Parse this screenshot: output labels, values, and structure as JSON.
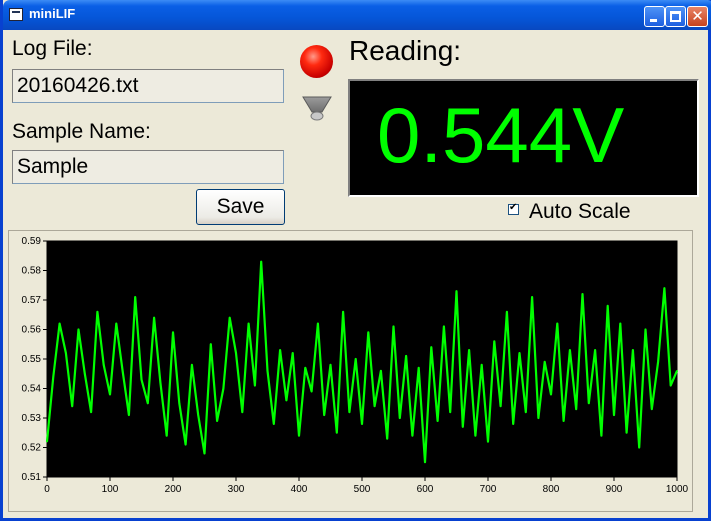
{
  "window": {
    "title": "miniLIF",
    "colors": {
      "titlebar": "#0556D8",
      "face": "#ECE9D8"
    }
  },
  "titlebar_buttons": {
    "min_icon": "minimize-icon",
    "max_icon": "maximize-icon",
    "close_icon": "close-icon",
    "close_glyph": "✕"
  },
  "log_file": {
    "label": "Log File:",
    "value": "20160426.txt"
  },
  "sample_name": {
    "label": "Sample Name:",
    "value": "Sample"
  },
  "save_label": "Save",
  "indicators": {
    "active": "red-led-icon",
    "inactive": "grey-led-icon"
  },
  "reading": {
    "label": "Reading:",
    "value": "0.544V",
    "color": "#00FF00"
  },
  "auto_scale": {
    "label": "Auto Scale",
    "checked": true
  },
  "chart_data": {
    "type": "line",
    "title": "",
    "xlabel": "",
    "ylabel": "",
    "xlim": [
      0,
      1000
    ],
    "ylim": [
      0.51,
      0.59
    ],
    "x_ticks": [
      "0",
      "100",
      "200",
      "300",
      "400",
      "500",
      "600",
      "700",
      "800",
      "900",
      "1000"
    ],
    "y_ticks": [
      "0.51",
      "0.52",
      "0.53",
      "0.54",
      "0.55",
      "0.56",
      "0.57",
      "0.58",
      "0.59"
    ],
    "line_color": "#00FF00",
    "background": "#000000",
    "series": [
      {
        "x": [
          0,
          10,
          20,
          30,
          40,
          50,
          60,
          70,
          80,
          90,
          100,
          110,
          120,
          130,
          140,
          150,
          160,
          170,
          180,
          190,
          200,
          210,
          220,
          230,
          240,
          250,
          260,
          270,
          280,
          290,
          300,
          310,
          320,
          330,
          340,
          350,
          360,
          370,
          380,
          390,
          400,
          410,
          420,
          430,
          440,
          450,
          460,
          470,
          480,
          490,
          500,
          510,
          520,
          530,
          540,
          550,
          560,
          570,
          580,
          590,
          600,
          610,
          620,
          630,
          640,
          650,
          660,
          670,
          680,
          690,
          700,
          710,
          720,
          730,
          740,
          750,
          760,
          770,
          780,
          790,
          800,
          810,
          820,
          830,
          840,
          850,
          860,
          870,
          880,
          890,
          900,
          910,
          920,
          930,
          940,
          950,
          960,
          970,
          980,
          990,
          1000
        ],
        "y": [
          0.522,
          0.544,
          0.562,
          0.552,
          0.534,
          0.56,
          0.545,
          0.532,
          0.566,
          0.548,
          0.538,
          0.562,
          0.546,
          0.531,
          0.571,
          0.543,
          0.535,
          0.564,
          0.542,
          0.524,
          0.559,
          0.535,
          0.521,
          0.548,
          0.531,
          0.518,
          0.555,
          0.529,
          0.54,
          0.564,
          0.552,
          0.532,
          0.562,
          0.541,
          0.583,
          0.546,
          0.528,
          0.553,
          0.536,
          0.552,
          0.524,
          0.547,
          0.539,
          0.562,
          0.531,
          0.548,
          0.525,
          0.566,
          0.532,
          0.55,
          0.528,
          0.559,
          0.534,
          0.546,
          0.523,
          0.561,
          0.53,
          0.551,
          0.524,
          0.547,
          0.515,
          0.554,
          0.529,
          0.561,
          0.532,
          0.573,
          0.527,
          0.553,
          0.524,
          0.548,
          0.522,
          0.556,
          0.534,
          0.566,
          0.528,
          0.552,
          0.532,
          0.571,
          0.53,
          0.549,
          0.538,
          0.562,
          0.529,
          0.553,
          0.533,
          0.572,
          0.535,
          0.553,
          0.524,
          0.568,
          0.531,
          0.562,
          0.525,
          0.553,
          0.52,
          0.56,
          0.533,
          0.549,
          0.574,
          0.541,
          0.546
        ]
      }
    ]
  }
}
